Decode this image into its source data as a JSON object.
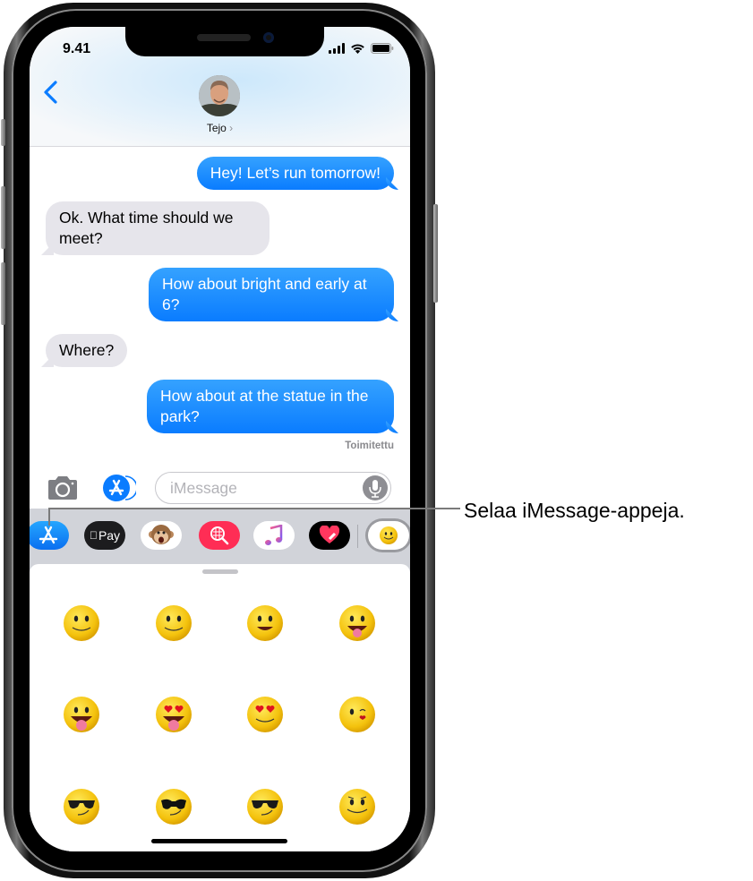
{
  "status_bar": {
    "time": "9.41",
    "icons": [
      "cellular-signal-icon",
      "wifi-icon",
      "battery-icon"
    ]
  },
  "header": {
    "back_icon": "chevron-left-icon",
    "contact_name": "Tejo",
    "contact_chevron": "›"
  },
  "messages": [
    {
      "direction": "outgoing",
      "text": "Hey! Let’s run tomorrow!"
    },
    {
      "direction": "incoming",
      "text": "Ok. What time should we meet?"
    },
    {
      "direction": "outgoing",
      "text": "How about bright and early at 6?"
    },
    {
      "direction": "incoming",
      "text": "Where?"
    },
    {
      "direction": "outgoing",
      "text": "How about at the statue in the park?"
    }
  ],
  "delivery_status": "Toimitettu",
  "composer": {
    "placeholder": "iMessage",
    "value": "",
    "camera_icon": "camera-icon",
    "apps_icon": "app-store-icon",
    "mic_icon": "microphone-icon"
  },
  "app_drawer": [
    {
      "name": "App Store",
      "icon": "app-store-icon",
      "bg": "#1a8cff"
    },
    {
      "name": "Apple Pay",
      "icon": "apple-pay-icon",
      "label": "Pay",
      "bg": "#1c1c1e"
    },
    {
      "name": "Animoji",
      "icon": "monkey-icon",
      "bg": "#ffffff"
    },
    {
      "name": "Web Images",
      "icon": "image-search-icon",
      "bg": "#ff2d55"
    },
    {
      "name": "Music",
      "icon": "music-note-icon",
      "bg": "#ffffff"
    },
    {
      "name": "Digital Touch",
      "icon": "heart-icon",
      "bg": "#000000"
    },
    {
      "name": "Stickers",
      "icon": "smiley-sticker-icon",
      "bg": "#ffffff",
      "selected": true
    }
  ],
  "stickers": [
    "smile",
    "smile",
    "grin",
    "tongue-out",
    "big-tongue",
    "heart-eyes-tongue",
    "heart-eyes",
    "wink-kiss",
    "sunglasses-smirk",
    "sunglasses-aviator",
    "sunglasses-smirk-2",
    "sly-smile"
  ],
  "callout": {
    "text": "Selaa iMessage-appeja."
  },
  "colors": {
    "outgoing_bubble": "#0a7cff",
    "incoming_bubble": "#e6e5eb",
    "accent": "#007aff",
    "drawer_bg": "#d1d3d9"
  }
}
